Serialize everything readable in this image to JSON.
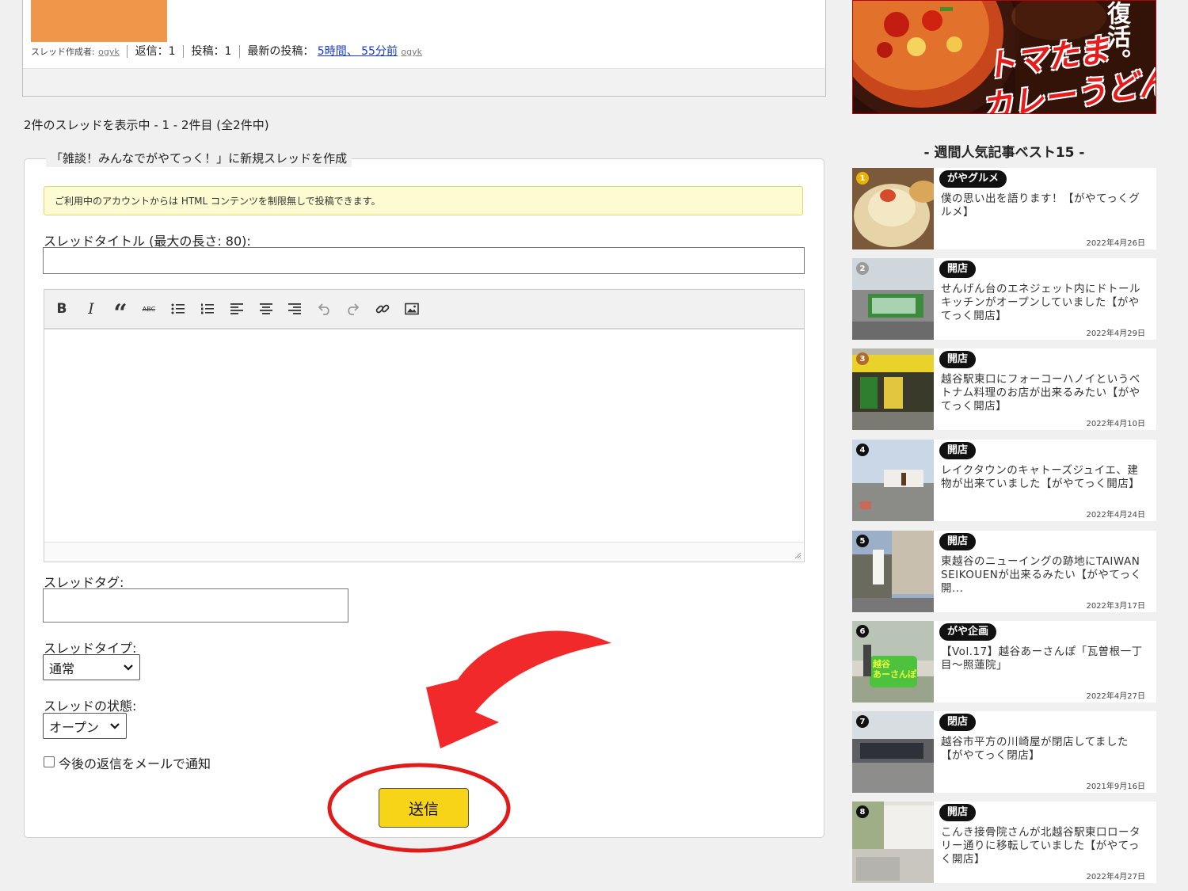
{
  "thread_meta": {
    "creator_label": "スレッド作成者:",
    "creator_name": "ogyk",
    "replies": "返信：1",
    "posts": "投稿：1",
    "latest_label": "最新の投稿：",
    "latest_time": "5時間、 55分前",
    "latest_user": "ogyk"
  },
  "listing_count": "2件のスレッドを表示中 - 1 - 2件目 (全2件中)",
  "form": {
    "legend": "「雑談！みんなでがやてっく！」に新規スレッドを作成",
    "notice": "ご利用中のアカウントからは HTML コンテンツを制限無しで投稿できます。",
    "title_label": "スレッドタイトル (最大の長さ: 80):",
    "toolbar": [
      "bold-icon",
      "italic-icon",
      "blockquote-icon",
      "strikethrough-icon",
      "bullet-list-icon",
      "numbered-list-icon",
      "align-left-icon",
      "align-center-icon",
      "align-right-icon",
      "undo-icon",
      "redo-icon",
      "link-icon",
      "image-icon"
    ],
    "toolbar_glyphs": {
      "bold": "B",
      "italic": "I",
      "quote": "“",
      "strike": "ABC"
    },
    "tag_label": "スレッドタグ:",
    "type_label": "スレッドタイプ:",
    "type_value": "通常",
    "status_label": "スレッドの状態:",
    "status_value": "オープン",
    "notify_label": "今後の返信をメールで通知",
    "submit_label": "送信"
  },
  "ad": {
    "text_top": "復活。",
    "text_main_1": "トマたま",
    "text_main_2": "カレーうどん"
  },
  "sidebar": {
    "title": "- 週間人気記事ベスト15 -",
    "articles": [
      {
        "rank": "1",
        "category": "がやグルメ",
        "title": "僕の思い出を語ります！【がやてっくグルメ】",
        "date": "2022年4月26日",
        "rank_color": "#e8b400"
      },
      {
        "rank": "2",
        "category": "開店",
        "title": "せんげん台のエネジェット内にドトールキッチンがオープンしていました【がやてっく開店】",
        "date": "2022年4月29日",
        "rank_color": "#9a9a9a"
      },
      {
        "rank": "3",
        "category": "開店",
        "title": "越谷駅東口にフォーコーハノイというベトナム料理のお店が出来るみたい【がやてっく開店】",
        "date": "2022年4月10日",
        "rank_color": "#b06a2a"
      },
      {
        "rank": "4",
        "category": "開店",
        "title": "レイクタウンのキャトーズジュイエ、建物が出来ていました【がやてっく開店】",
        "date": "2022年4月24日",
        "rank_color": "#111111"
      },
      {
        "rank": "5",
        "category": "開店",
        "title": "東越谷のニューイングの跡地にTAIWAN SEIKOUENが出来るみたい【がやてっく開...",
        "date": "2022年3月17日",
        "rank_color": "#111111"
      },
      {
        "rank": "6",
        "category": "がや企画",
        "title": "【Vol.17】越谷あーさんぽ「瓦曽根一丁目～照蓮院」",
        "date": "2022年4月27日",
        "rank_color": "#111111"
      },
      {
        "rank": "7",
        "category": "閉店",
        "title": "越谷市平方の川崎屋が閉店してました【がやてっく閉店】",
        "date": "2021年9月16日",
        "rank_color": "#111111"
      },
      {
        "rank": "8",
        "category": "開店",
        "title": "こんき接骨院さんが北越谷駅東口ロータリー通りに移転していました【がやてっく開店】",
        "date": "2022年4月27日",
        "rank_color": "#111111"
      }
    ],
    "sign_text_6": "越谷\nあーさんぽ"
  },
  "colors": {
    "annotation_red": "#e52222",
    "submit_yellow": "#f7d417",
    "notice_bg": "#fdfbd1",
    "link_blue": "#1a3cc8"
  }
}
